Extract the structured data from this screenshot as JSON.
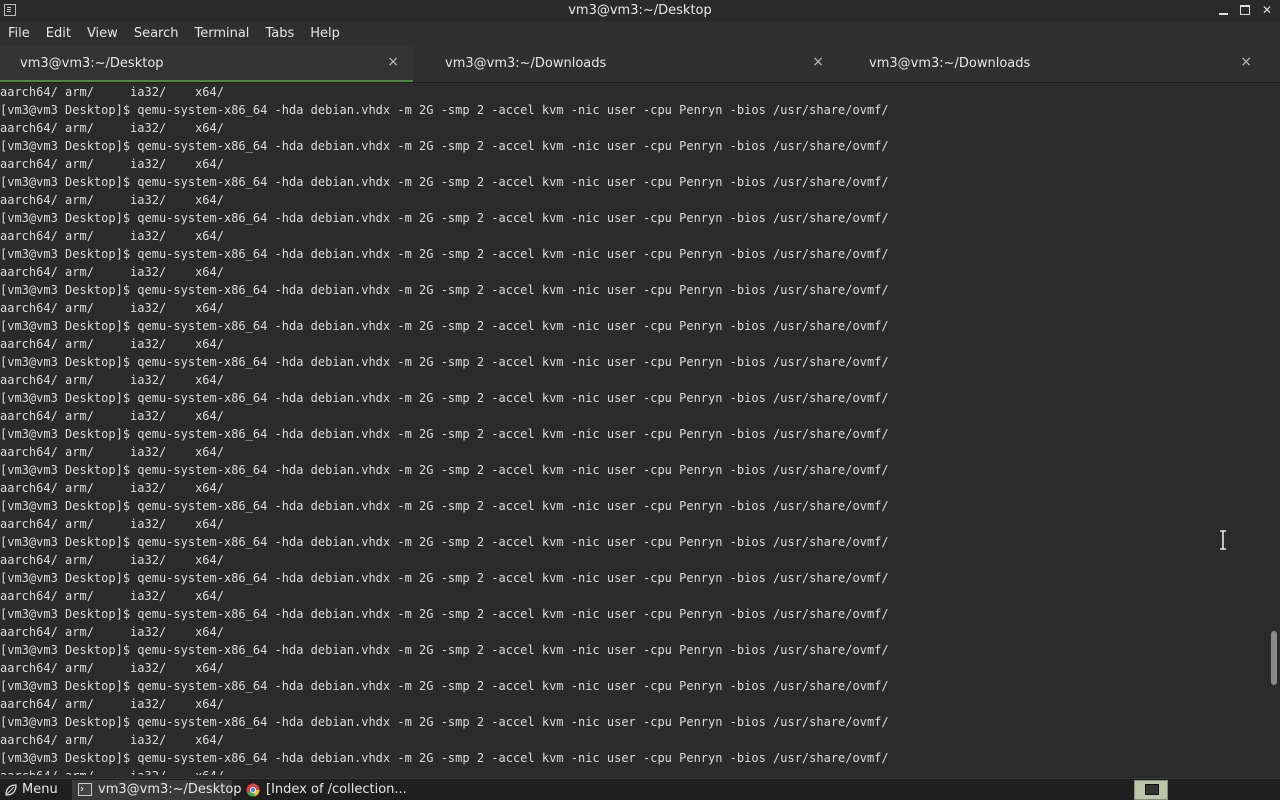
{
  "window": {
    "title": "vm3@vm3:~/Desktop"
  },
  "menubar": {
    "items": [
      "File",
      "Edit",
      "View",
      "Search",
      "Terminal",
      "Tabs",
      "Help"
    ]
  },
  "tabs": [
    {
      "label": "vm3@vm3:~/Desktop",
      "close": "×",
      "active": true
    },
    {
      "label": "vm3@vm3:~/Downloads",
      "close": "×",
      "active": false
    },
    {
      "label": "vm3@vm3:~/Downloads",
      "close": "×",
      "active": false
    }
  ],
  "terminal": {
    "lines": [
      "aarch64/ arm/     ia32/    x64/",
      "[vm3@vm3 Desktop]$ qemu-system-x86_64 -hda debian.vhdx -m 2G -smp 2 -accel kvm -nic user -cpu Penryn -bios /usr/share/ovmf/",
      "aarch64/ arm/     ia32/    x64/",
      "[vm3@vm3 Desktop]$ qemu-system-x86_64 -hda debian.vhdx -m 2G -smp 2 -accel kvm -nic user -cpu Penryn -bios /usr/share/ovmf/",
      "aarch64/ arm/     ia32/    x64/",
      "[vm3@vm3 Desktop]$ qemu-system-x86_64 -hda debian.vhdx -m 2G -smp 2 -accel kvm -nic user -cpu Penryn -bios /usr/share/ovmf/",
      "aarch64/ arm/     ia32/    x64/",
      "[vm3@vm3 Desktop]$ qemu-system-x86_64 -hda debian.vhdx -m 2G -smp 2 -accel kvm -nic user -cpu Penryn -bios /usr/share/ovmf/",
      "aarch64/ arm/     ia32/    x64/",
      "[vm3@vm3 Desktop]$ qemu-system-x86_64 -hda debian.vhdx -m 2G -smp 2 -accel kvm -nic user -cpu Penryn -bios /usr/share/ovmf/",
      "aarch64/ arm/     ia32/    x64/",
      "[vm3@vm3 Desktop]$ qemu-system-x86_64 -hda debian.vhdx -m 2G -smp 2 -accel kvm -nic user -cpu Penryn -bios /usr/share/ovmf/",
      "aarch64/ arm/     ia32/    x64/",
      "[vm3@vm3 Desktop]$ qemu-system-x86_64 -hda debian.vhdx -m 2G -smp 2 -accel kvm -nic user -cpu Penryn -bios /usr/share/ovmf/",
      "aarch64/ arm/     ia32/    x64/",
      "[vm3@vm3 Desktop]$ qemu-system-x86_64 -hda debian.vhdx -m 2G -smp 2 -accel kvm -nic user -cpu Penryn -bios /usr/share/ovmf/",
      "aarch64/ arm/     ia32/    x64/",
      "[vm3@vm3 Desktop]$ qemu-system-x86_64 -hda debian.vhdx -m 2G -smp 2 -accel kvm -nic user -cpu Penryn -bios /usr/share/ovmf/",
      "aarch64/ arm/     ia32/    x64/",
      "[vm3@vm3 Desktop]$ qemu-system-x86_64 -hda debian.vhdx -m 2G -smp 2 -accel kvm -nic user -cpu Penryn -bios /usr/share/ovmf/",
      "aarch64/ arm/     ia32/    x64/",
      "[vm3@vm3 Desktop]$ qemu-system-x86_64 -hda debian.vhdx -m 2G -smp 2 -accel kvm -nic user -cpu Penryn -bios /usr/share/ovmf/",
      "aarch64/ arm/     ia32/    x64/",
      "[vm3@vm3 Desktop]$ qemu-system-x86_64 -hda debian.vhdx -m 2G -smp 2 -accel kvm -nic user -cpu Penryn -bios /usr/share/ovmf/",
      "aarch64/ arm/     ia32/    x64/",
      "[vm3@vm3 Desktop]$ qemu-system-x86_64 -hda debian.vhdx -m 2G -smp 2 -accel kvm -nic user -cpu Penryn -bios /usr/share/ovmf/",
      "aarch64/ arm/     ia32/    x64/",
      "[vm3@vm3 Desktop]$ qemu-system-x86_64 -hda debian.vhdx -m 2G -smp 2 -accel kvm -nic user -cpu Penryn -bios /usr/share/ovmf/",
      "aarch64/ arm/     ia32/    x64/",
      "[vm3@vm3 Desktop]$ qemu-system-x86_64 -hda debian.vhdx -m 2G -smp 2 -accel kvm -nic user -cpu Penryn -bios /usr/share/ovmf/",
      "aarch64/ arm/     ia32/    x64/",
      "[vm3@vm3 Desktop]$ qemu-system-x86_64 -hda debian.vhdx -m 2G -smp 2 -accel kvm -nic user -cpu Penryn -bios /usr/share/ovmf/",
      "aarch64/ arm/     ia32/    x64/",
      "[vm3@vm3 Desktop]$ qemu-system-x86_64 -hda debian.vhdx -m 2G -smp 2 -accel kvm -nic user -cpu Penryn -bios /usr/share/ovmf/",
      "aarch64/ arm/     ia32/    x64/",
      "[vm3@vm3 Desktop]$ qemu-system-x86_64 -hda debian.vhdx -m 2G -smp 2 -accel kvm -nic user -cpu Penryn -bios /usr/share/ovmf/",
      "aarch64/ arm/     ia32/    x64/",
      "[vm3@vm3 Desktop]$ qemu-system-x86_64 -hda debian.vhdx -m 2G -smp 2 -accel kvm -nic user -cpu Penryn -bios /usr/share/ovmf/",
      "aarch64/ arm/     ia32/    x64/"
    ]
  },
  "taskbar": {
    "menu_label": "Menu",
    "items": [
      {
        "label": "vm3@vm3:~/Desktop",
        "icon": "terminal-icon"
      },
      {
        "label": "[Index of /collection...",
        "icon": "chrome-icon"
      }
    ]
  },
  "colors": {
    "terminal_bg": "#2b2b2b",
    "terminal_fg": "#dcdcdc",
    "active_tab_accent": "#4a8c3a"
  }
}
